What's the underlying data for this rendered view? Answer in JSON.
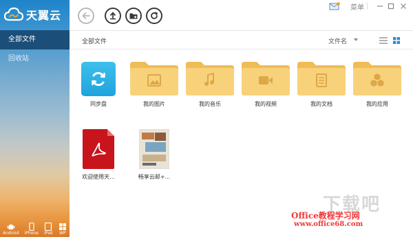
{
  "app": {
    "name": "天翼云"
  },
  "sidebar": {
    "items": [
      {
        "label": "全部文件",
        "active": true
      },
      {
        "label": "回收站",
        "active": false
      }
    ],
    "devices": [
      {
        "label": "Android",
        "icon": "android-icon"
      },
      {
        "label": "iPhone",
        "icon": "iphone-icon"
      },
      {
        "label": "iPad",
        "icon": "ipad-icon"
      },
      {
        "label": "WP",
        "icon": "windows-phone-icon"
      }
    ]
  },
  "window": {
    "menu_label": "菜单"
  },
  "breadcrumb": "全部文件",
  "sort": {
    "label": "文件名"
  },
  "files": [
    {
      "name": "同步盘",
      "type": "sync",
      "icon": "sync-icon"
    },
    {
      "name": "我的图片",
      "type": "folder",
      "icon": "image-icon"
    },
    {
      "name": "我的音乐",
      "type": "folder",
      "icon": "music-icon"
    },
    {
      "name": "我的视频",
      "type": "folder",
      "icon": "video-icon"
    },
    {
      "name": "我的文档",
      "type": "folder",
      "icon": "document-icon"
    },
    {
      "name": "我的应用",
      "type": "folder",
      "icon": "apps-icon"
    },
    {
      "name": "欢迎使用天...",
      "type": "pdf",
      "icon": "pdf-icon"
    },
    {
      "name": "畅享云邮+...",
      "type": "image",
      "icon": "image-thumbnail"
    }
  ],
  "watermark": {
    "big": "下载吧",
    "line1": "Office教程学习网",
    "line2": "www.office68.com"
  },
  "colors": {
    "sidebar_active": "#1b4e78",
    "folder": "#f5c96a",
    "sync": "#29a9e1",
    "pdf": "#c8141b"
  }
}
